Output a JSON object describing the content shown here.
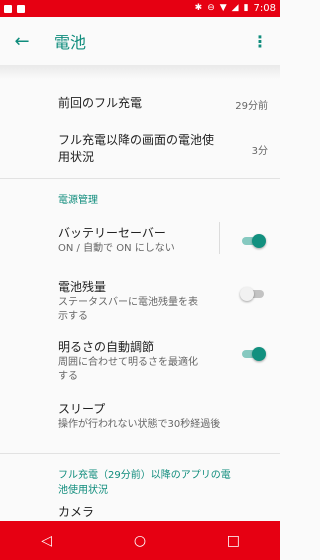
{
  "status": {
    "time": "7:08"
  },
  "appbar": {
    "title": "電池"
  },
  "summary": [
    {
      "title": "前回のフル充電",
      "value": "29分前"
    },
    {
      "title": "フル充電以降の画面の電池使用状況",
      "value": "3分"
    }
  ],
  "power": {
    "header": "電源管理",
    "battery_saver": {
      "title": "バッテリーセーバー",
      "subtitle": "ON / 自動で ON にしない",
      "on": true
    },
    "battery_percent": {
      "title": "電池残量",
      "subtitle": "ステータスバーに電池残量を表示する",
      "on": false
    },
    "adaptive_brightness": {
      "title": "明るさの自動調節",
      "subtitle": "周囲に合わせて明るさを最適化する",
      "on": true
    },
    "sleep": {
      "title": "スリープ",
      "subtitle": "操作が行われない状態で30秒経過後"
    }
  },
  "usage": {
    "header": "フル充電（29分前）以降のアプリの電池使用状況",
    "partial_item": "カメラ"
  },
  "colors": {
    "status_bar": "#e60012",
    "accent": "#0f8c7c",
    "nav_bar": "#e60012"
  },
  "icons": {
    "status_left": [
      "image-icon",
      "sim-icon"
    ],
    "status_right": [
      "bluetooth-icon",
      "do-not-disturb-icon",
      "wifi-icon",
      "signal-icon",
      "battery-icon"
    ],
    "nav": [
      "back-icon",
      "home-icon",
      "recents-icon"
    ]
  }
}
